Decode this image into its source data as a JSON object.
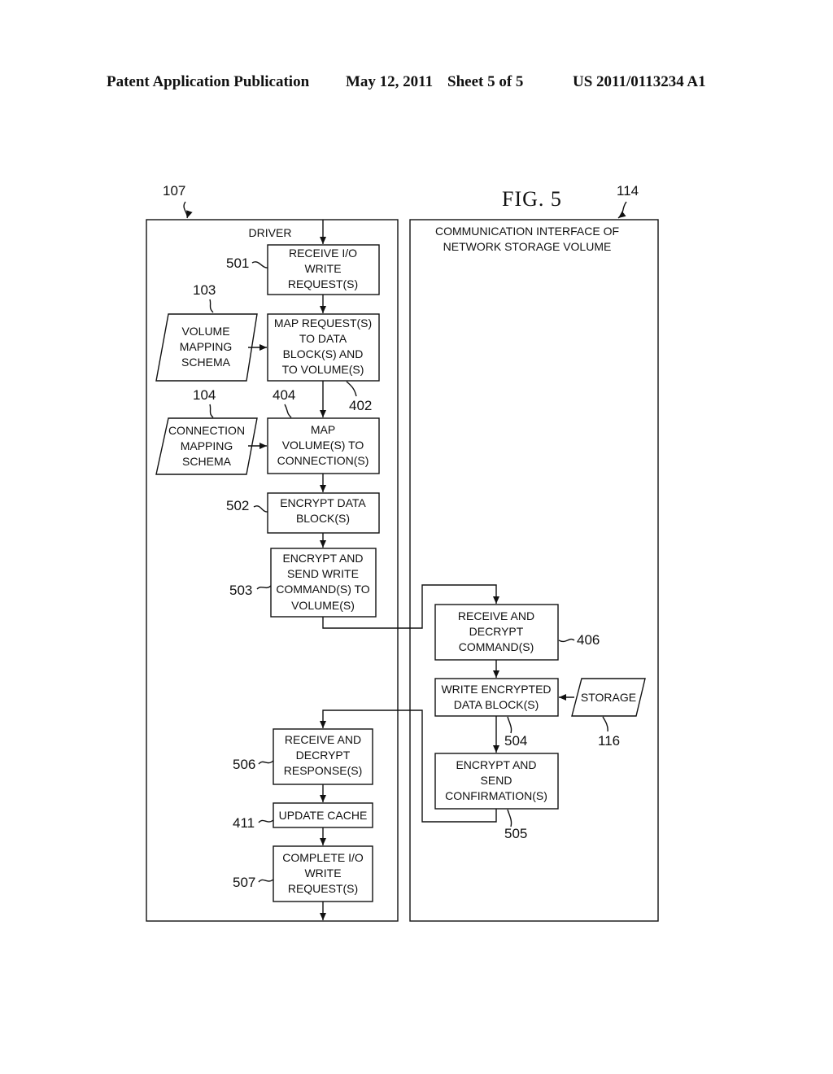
{
  "header": {
    "publication": "Patent Application Publication",
    "date": "May 12, 2011",
    "sheet": "Sheet 5 of 5",
    "number": "US 2011/0113234 A1"
  },
  "figure": {
    "title": "FIG. 5"
  },
  "panels": {
    "driver": {
      "ref": "107",
      "title": "DRIVER"
    },
    "interface": {
      "ref": "114",
      "title_lines": [
        "COMMUNICATION INTERFACE OF",
        "NETWORK STORAGE VOLUME"
      ]
    }
  },
  "steps": {
    "s501": {
      "ref": "501",
      "lines": [
        "RECEIVE I/O",
        "WRITE",
        "REQUEST(S)"
      ]
    },
    "s402": {
      "ref": "402",
      "lines": [
        "MAP REQUEST(S)",
        "TO DATA",
        "BLOCK(S) AND",
        "TO VOLUME(S)"
      ]
    },
    "s404": {
      "ref": "404",
      "lines": [
        "MAP",
        "VOLUME(S) TO",
        "CONNECTION(S)"
      ]
    },
    "s502": {
      "ref": "502",
      "lines": [
        "ENCRYPT DATA",
        "BLOCK(S)"
      ]
    },
    "s503": {
      "ref": "503",
      "lines": [
        "ENCRYPT AND",
        "SEND WRITE",
        "COMMAND(S) TO",
        "VOLUME(S)"
      ]
    },
    "s406": {
      "ref": "406",
      "lines": [
        "RECEIVE AND",
        "DECRYPT",
        "COMMAND(S)"
      ]
    },
    "s504": {
      "ref": "504",
      "lines": [
        "WRITE ENCRYPTED",
        "DATA BLOCK(S)"
      ]
    },
    "s505": {
      "ref": "505",
      "lines": [
        "ENCRYPT AND",
        "SEND",
        "CONFIRMATION(S)"
      ]
    },
    "s506": {
      "ref": "506",
      "lines": [
        "RECEIVE AND",
        "DECRYPT",
        "RESPONSE(S)"
      ]
    },
    "s411": {
      "ref": "411",
      "lines": [
        "UPDATE CACHE"
      ]
    },
    "s507": {
      "ref": "507",
      "lines": [
        "COMPLETE I/O",
        "WRITE",
        "REQUEST(S)"
      ]
    }
  },
  "data_stores": {
    "d103": {
      "ref": "103",
      "lines": [
        "VOLUME",
        "MAPPING",
        "SCHEMA"
      ]
    },
    "d104": {
      "ref": "104",
      "lines": [
        "CONNECTION",
        "MAPPING",
        "SCHEMA"
      ]
    },
    "d116": {
      "ref": "116",
      "lines": [
        "STORAGE"
      ]
    }
  }
}
